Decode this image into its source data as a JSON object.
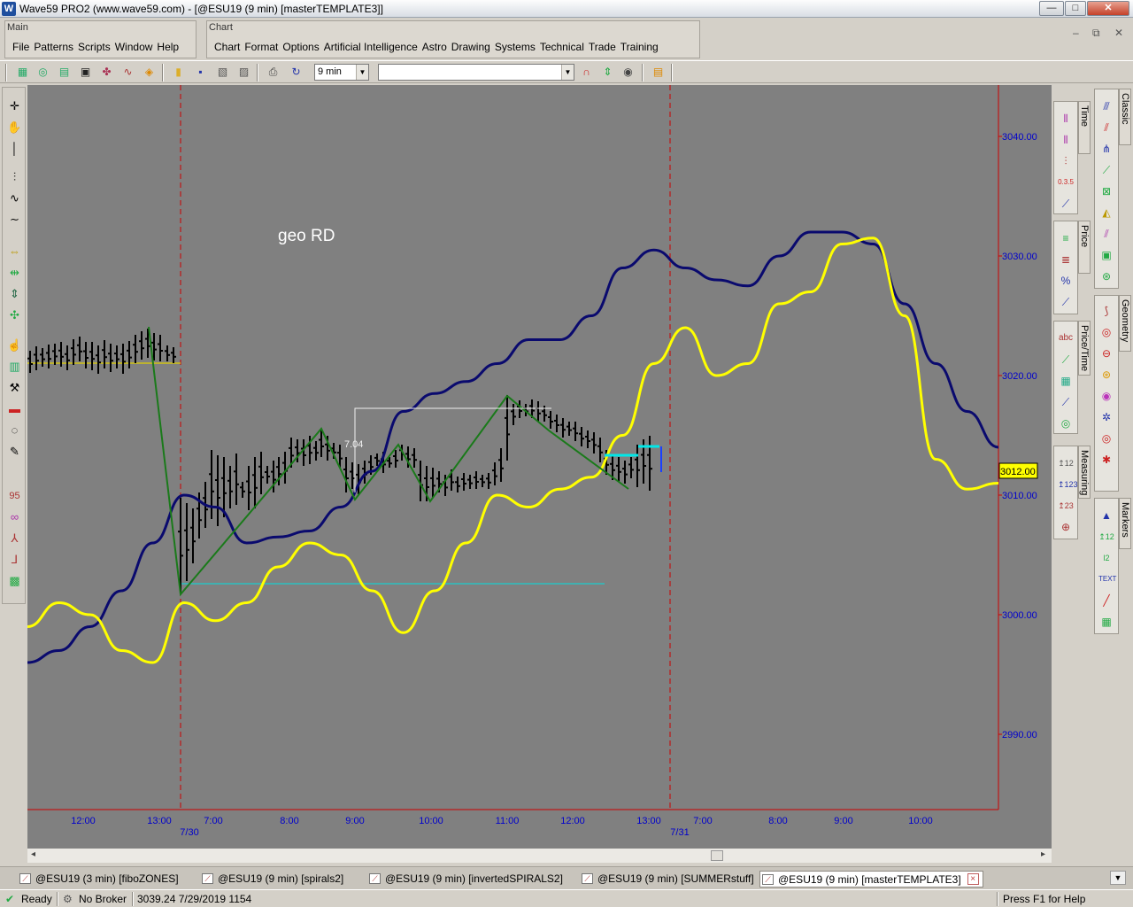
{
  "window": {
    "title": "Wave59 PRO2 (www.wave59.com) - [@ESU19 (9 min) [masterTEMPLATE3]]",
    "app_icon": "W",
    "minimize": "—",
    "maximize": "□",
    "close": "✕"
  },
  "main_group": {
    "label": "Main",
    "menus": [
      "File",
      "Patterns",
      "Scripts",
      "Window",
      "Help"
    ]
  },
  "chart_group": {
    "label": "Chart",
    "menus": [
      "Chart",
      "Format",
      "Options",
      "Artificial Intelligence",
      "Astro",
      "Drawing",
      "Systems",
      "Technical",
      "Trade",
      "Training"
    ]
  },
  "mdi_controls": {
    "minimize": "–",
    "restore": "⧉",
    "close": "✕"
  },
  "toolbar": {
    "interval": "9 min",
    "symbol": ""
  },
  "right_panels": {
    "time": "Time",
    "price": "Price",
    "price_time": "Price/Time",
    "measuring": "Measuring",
    "classic": "Classic",
    "geometry": "Geometry",
    "markers": "Markers"
  },
  "chart": {
    "annotation": "geo RD",
    "measure_label": "7.04",
    "price_label": "3012.00",
    "y_ticks": [
      "3040.00",
      "3030.00",
      "3020.00",
      "3010.00",
      "3000.00",
      "2990.00"
    ],
    "x_ticks": [
      "12:00",
      "13:00",
      "7:00",
      "8:00",
      "9:00",
      "10:00",
      "11:00",
      "12:00",
      "13:00",
      "7:00",
      "8:00",
      "9:00",
      "10:00"
    ],
    "date_labels": [
      "7/30",
      "7/31"
    ],
    "colors": {
      "background": "#808080",
      "axis": "#cc0000",
      "tick_text": "#0000cc",
      "navy_line": "#0a0a6e",
      "yellow_line": "#ffff00",
      "zigzag": "#1a7a1a",
      "cyan": "#00e0e0"
    }
  },
  "chart_data": {
    "type": "line",
    "ylim": [
      2985,
      3045
    ],
    "series": [
      {
        "y_approx_path": [
          2996,
          2997,
          2999,
          3002,
          3006,
          3010,
          3009,
          3006,
          3006.5,
          3007,
          3009,
          3012,
          3017,
          3018.5,
          3019.5,
          3021,
          3023,
          3023,
          3025,
          3029,
          3030.5,
          3029,
          3028,
          3027.5,
          3030,
          3032,
          3032,
          3031,
          3026,
          3021,
          3017,
          3014
        ]
      },
      {
        "y_approx_path": [
          2999,
          3001,
          3000,
          2997,
          2996,
          3001,
          2999.5,
          3001,
          3004,
          3006,
          3005,
          3002,
          2998.5,
          3002,
          3006,
          3010,
          3009,
          3010.5,
          3011.5,
          3015,
          3021,
          3024,
          3020,
          3021,
          3026,
          3027,
          3031,
          3031.5,
          3025,
          3013,
          3010.5,
          3011
        ]
      }
    ]
  },
  "document_tabs": [
    {
      "label": "@ESU19 (3 min) [fiboZONES]",
      "active": false
    },
    {
      "label": "@ESU19 (9 min) [spirals2]",
      "active": false
    },
    {
      "label": "@ESU19 (9 min) [invertedSPIRALS2]",
      "active": false
    },
    {
      "label": "@ESU19 (9 min) [SUMMERstuff]",
      "active": false
    },
    {
      "label": "@ESU19 (9 min) [masterTEMPLATE3]",
      "active": true
    }
  ],
  "status": {
    "ready": "Ready",
    "broker": "No Broker",
    "readout": "3039.24  7/29/2019  1154",
    "help": "Press F1 for Help"
  },
  "scroll": {
    "left": "◂",
    "right": "▸"
  }
}
